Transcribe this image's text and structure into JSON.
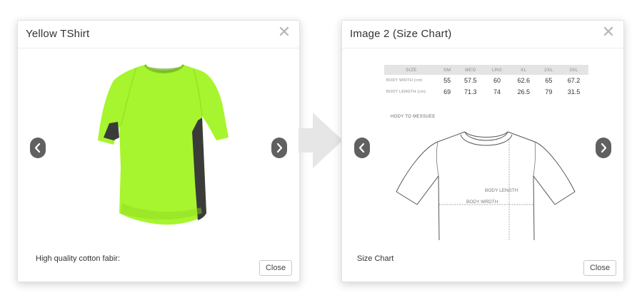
{
  "modal_left": {
    "title": "Yellow TShirt",
    "caption": "High quality cotton fabir:",
    "close_label": "Close",
    "close_icon": "✕",
    "prev_icon": "chevron-left-icon",
    "next_icon": "chevron-right-icon",
    "product_colors": {
      "shirt": "#a6f52e",
      "side_panel": "#3a3c3a"
    }
  },
  "modal_right": {
    "title": "Image 2 (Size Chart)",
    "caption": "Size Chart",
    "close_label": "Close",
    "close_icon": "✕",
    "size_table": {
      "headers": [
        "SIZE",
        "SM",
        "MED",
        "LRG",
        "XL",
        "2XL",
        "3XL"
      ],
      "rows": [
        {
          "label": "BODY WIDTH (cm)",
          "values": [
            "55",
            "57.5",
            "60",
            "62.6",
            "65",
            "67.2"
          ]
        },
        {
          "label": "BODY LENGTH (cm)",
          "values": [
            "69",
            "71.3",
            "74",
            "26.5",
            "79",
            "31.5"
          ]
        }
      ]
    },
    "measure_caption": "HODY TO MESSUEE",
    "diagram_labels": {
      "length": "BODY LENGTH",
      "width": "BODY WRDTH"
    }
  },
  "colors": {
    "nav_button": "#606060",
    "arrow": "#e6e6e6",
    "border": "#e2e2e2"
  }
}
